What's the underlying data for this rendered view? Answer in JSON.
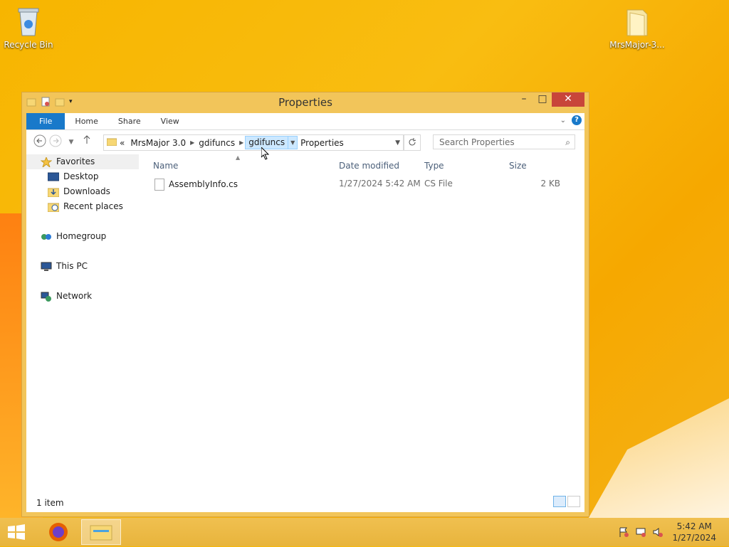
{
  "desktop": {
    "icons": [
      {
        "label": "Recycle Bin"
      },
      {
        "label": "MrsMajor-3..."
      }
    ]
  },
  "window": {
    "title": "Properties",
    "controls": {
      "minimize": "–",
      "maximize": "□",
      "close": "✕"
    }
  },
  "ribbon": {
    "tabs": [
      "File",
      "Home",
      "Share",
      "View"
    ],
    "help": "?"
  },
  "address": {
    "overflow": "«",
    "segments": [
      "MrsMajor 3.0",
      "gdifuncs",
      "gdifuncs",
      "Properties"
    ]
  },
  "search": {
    "placeholder": "Search Properties"
  },
  "nav_pane": {
    "favorites": "Favorites",
    "favorite_items": [
      "Desktop",
      "Downloads",
      "Recent places"
    ],
    "homegroup": "Homegroup",
    "this_pc": "This PC",
    "network": "Network"
  },
  "columns": {
    "name": "Name",
    "date": "Date modified",
    "type": "Type",
    "size": "Size"
  },
  "files": [
    {
      "name": "AssemblyInfo.cs",
      "date": "1/27/2024 5:42 AM",
      "type": "CS File",
      "size": "2 KB"
    }
  ],
  "status": {
    "count": "1 item"
  },
  "taskbar": {
    "time": "5:42 AM",
    "date": "1/27/2024"
  },
  "colors": {
    "accent": "#1979ca",
    "title_bar": "#f2c55a",
    "close": "#c8453a"
  }
}
